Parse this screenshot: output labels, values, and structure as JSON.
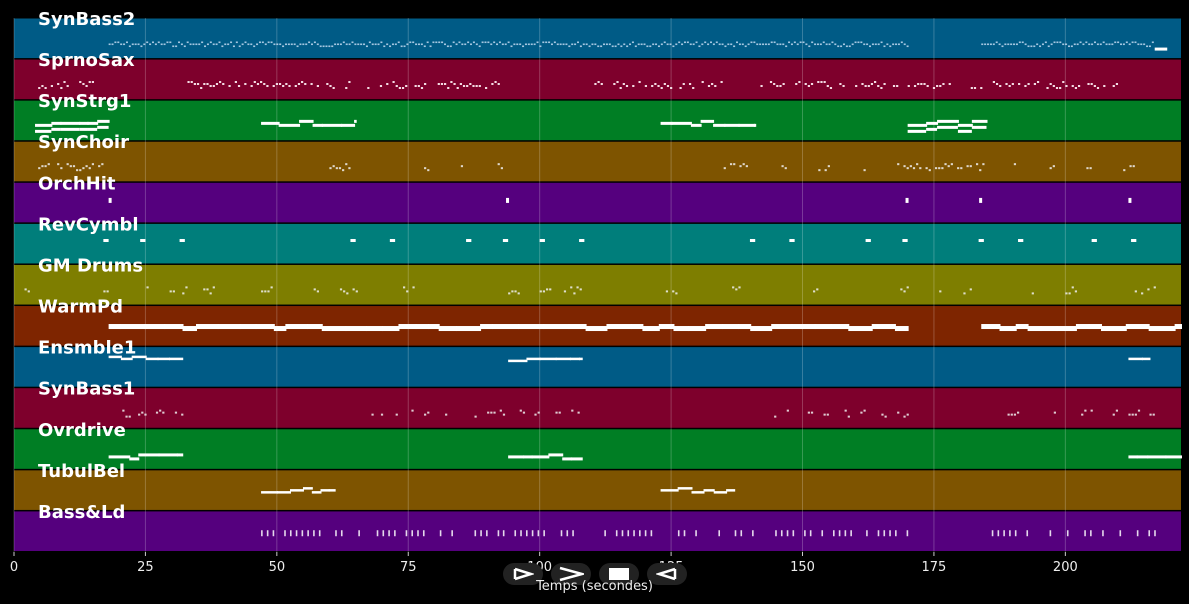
{
  "chart_data": {
    "type": "piano-roll",
    "xlabel": "Temps (secondes)",
    "xlim": [
      0,
      222
    ],
    "xticks": [
      0,
      25,
      50,
      75,
      100,
      125,
      150,
      175,
      200
    ],
    "grid": true,
    "tracks": [
      {
        "name": "SynBass2",
        "color": "#005b86",
        "pattern": "dense-thin",
        "segments": [
          [
            18,
            170
          ],
          [
            184,
            217
          ]
        ],
        "notes": [
          [
            217,
            219
          ]
        ]
      },
      {
        "name": "SprnoSax",
        "color": "#7e002c",
        "pattern": "phrases",
        "segments": [
          [
            4,
            16
          ],
          [
            33,
            64
          ],
          [
            66,
            78
          ],
          [
            80,
            92
          ],
          [
            108,
            135
          ],
          [
            142,
            158
          ],
          [
            160,
            168
          ],
          [
            170,
            178
          ],
          [
            182,
            210
          ]
        ]
      },
      {
        "name": "SynStrg1",
        "color": "#007e24",
        "pattern": "blocks",
        "segments": [
          [
            4,
            18
          ],
          [
            47,
            65
          ],
          [
            123,
            141
          ],
          [
            170,
            185
          ]
        ]
      },
      {
        "name": "SynChoir",
        "color": "#7e5400",
        "pattern": "sparse-dots",
        "segments": [
          [
            4,
            18
          ],
          [
            60,
            64
          ],
          [
            71,
            72
          ],
          [
            78,
            79
          ],
          [
            85,
            86
          ],
          [
            92,
            93
          ],
          [
            135,
            140
          ],
          [
            146,
            147
          ],
          [
            153,
            155
          ],
          [
            161,
            162
          ],
          [
            168,
            185
          ],
          [
            189,
            191
          ],
          [
            197,
            198
          ],
          [
            204,
            205
          ],
          [
            211,
            213
          ]
        ]
      },
      {
        "name": "OrchHit",
        "color": "#55007e",
        "pattern": "single-notes",
        "notes": [
          [
            18,
            18.4
          ],
          [
            93.6,
            94
          ],
          [
            169.6,
            170
          ],
          [
            183.6,
            184
          ],
          [
            212,
            212.4
          ]
        ]
      },
      {
        "name": "RevCymbl",
        "color": "#007e7b",
        "pattern": "single-notes",
        "notes": [
          [
            17,
            18
          ],
          [
            24,
            25
          ],
          [
            31.5,
            32.5
          ],
          [
            64,
            65
          ],
          [
            71.5,
            72.5
          ],
          [
            86,
            87
          ],
          [
            93,
            94
          ],
          [
            100,
            101
          ],
          [
            107.5,
            108.5
          ],
          [
            140,
            141
          ],
          [
            147.5,
            148.5
          ],
          [
            162,
            163
          ],
          [
            169,
            170
          ],
          [
            183.5,
            184.5
          ],
          [
            191,
            192
          ],
          [
            205,
            206
          ],
          [
            212.5,
            213.5
          ]
        ]
      },
      {
        "name": "GM Drums",
        "color": "#7e7e00",
        "pattern": "sparse-dots",
        "segments": [
          [
            2,
            3
          ],
          [
            17,
            19
          ],
          [
            24,
            26
          ],
          [
            29,
            33
          ],
          [
            36,
            38
          ],
          [
            47,
            49
          ],
          [
            57,
            58
          ],
          [
            62,
            66
          ],
          [
            74,
            76
          ],
          [
            83,
            84
          ],
          [
            94,
            96
          ],
          [
            100,
            102
          ],
          [
            104,
            108
          ],
          [
            124,
            126
          ],
          [
            136,
            140
          ],
          [
            152,
            153
          ],
          [
            168,
            170
          ],
          [
            176,
            177
          ],
          [
            180,
            182
          ],
          [
            188,
            190
          ],
          [
            193,
            194
          ],
          [
            200,
            202
          ],
          [
            212,
            217
          ]
        ]
      },
      {
        "name": "WarmPd",
        "color": "#7e2500",
        "pattern": "long-bar",
        "segments": [
          [
            18,
            170
          ],
          [
            184,
            222
          ]
        ]
      },
      {
        "name": "Ensmble1",
        "color": "#005b86",
        "pattern": "bar",
        "segments": [
          [
            18,
            32
          ],
          [
            94,
            108
          ],
          [
            212,
            216
          ]
        ]
      },
      {
        "name": "SynBass1",
        "color": "#7e002c",
        "pattern": "sparse-dots",
        "segments": [
          [
            20,
            22
          ],
          [
            23,
            25
          ],
          [
            27,
            29
          ],
          [
            30,
            32
          ],
          [
            68,
            70
          ],
          [
            72,
            73
          ],
          [
            75,
            76
          ],
          [
            78,
            79
          ],
          [
            82,
            83
          ],
          [
            87,
            88
          ],
          [
            90,
            93
          ],
          [
            95,
            97
          ],
          [
            99,
            101
          ],
          [
            103,
            104
          ],
          [
            106,
            108
          ],
          [
            144,
            145
          ],
          [
            147,
            148
          ],
          [
            151,
            152
          ],
          [
            154,
            155
          ],
          [
            158,
            159
          ],
          [
            161,
            162
          ],
          [
            165,
            166
          ],
          [
            168,
            170
          ],
          [
            189,
            191
          ],
          [
            196,
            198
          ],
          [
            203,
            205
          ],
          [
            209,
            210
          ],
          [
            212,
            214
          ],
          [
            216,
            217
          ]
        ]
      },
      {
        "name": "Ovrdrive",
        "color": "#007e24",
        "pattern": "blocks-mid",
        "segments": [
          [
            18,
            32
          ],
          [
            94,
            108
          ],
          [
            212,
            222
          ]
        ]
      },
      {
        "name": "TubulBel",
        "color": "#7e5400",
        "pattern": "bar",
        "segments": [
          [
            47,
            61
          ],
          [
            123,
            137
          ]
        ]
      },
      {
        "name": "Bass&Ld",
        "color": "#55007e",
        "pattern": "vticks",
        "segments": [
          [
            47,
            59
          ],
          [
            60,
            66
          ],
          [
            69,
            80
          ],
          [
            81,
            92
          ],
          [
            93,
            102
          ],
          [
            104,
            108
          ],
          [
            109,
            122
          ],
          [
            123,
            135
          ],
          [
            136,
            146
          ],
          [
            147,
            160
          ],
          [
            161,
            170
          ],
          [
            186,
            195
          ],
          [
            197,
            205
          ],
          [
            207,
            217
          ]
        ]
      }
    ]
  },
  "controls": [
    {
      "name": "rewind",
      "icon": "rewind-icon"
    },
    {
      "name": "play",
      "icon": "play-icon"
    },
    {
      "name": "stop",
      "icon": "stop-icon"
    },
    {
      "name": "back",
      "icon": "back-icon"
    }
  ]
}
